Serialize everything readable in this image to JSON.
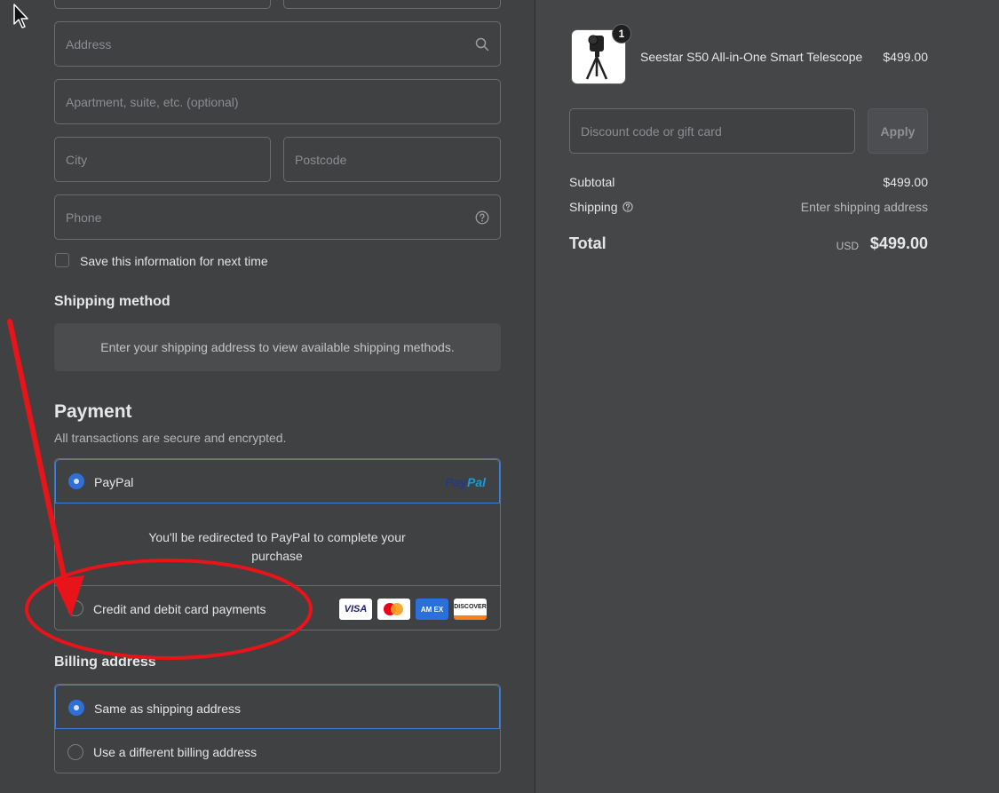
{
  "form": {
    "address_placeholder": "Address",
    "apartment_placeholder": "Apartment, suite, etc. (optional)",
    "city_placeholder": "City",
    "postcode_placeholder": "Postcode",
    "phone_placeholder": "Phone",
    "save_info_label": "Save this information for next time",
    "save_info_checked": false
  },
  "shipping_method": {
    "title": "Shipping method",
    "message": "Enter your shipping address to view available shipping methods."
  },
  "payment": {
    "title": "Payment",
    "subtitle": "All transactions are secure and encrypted.",
    "paypal_label": "PayPal",
    "paypal_logo_part1": "Pay",
    "paypal_logo_part2": "Pal",
    "paypal_selected": true,
    "redirect_message": "You'll be redirected to PayPal to complete your purchase",
    "card_label": "Credit and debit card payments",
    "card_selected": false,
    "card_brands": [
      "VISA",
      "mastercard",
      "AMEX",
      "DISCOVER"
    ],
    "card_brand_text": {
      "visa": "VISA",
      "amex": "AM EX",
      "discover": "DISCOVER"
    }
  },
  "billing": {
    "title": "Billing address",
    "same_label": "Same as shipping address",
    "same_selected": true,
    "different_label": "Use a different billing address"
  },
  "order": {
    "item_quantity": "1",
    "item_name": "Seestar S50 All-in-One Smart Telescope",
    "item_price": "$499.00",
    "discount_placeholder": "Discount code or gift card",
    "apply_label": "Apply",
    "subtotal_label": "Subtotal",
    "subtotal_value": "$499.00",
    "shipping_label": "Shipping",
    "shipping_value": "Enter shipping address",
    "total_label": "Total",
    "total_currency": "USD",
    "total_value": "$499.00"
  },
  "colors": {
    "background": "#3f4143",
    "accent": "#2f6fd6",
    "annotation": "#e8141a"
  }
}
